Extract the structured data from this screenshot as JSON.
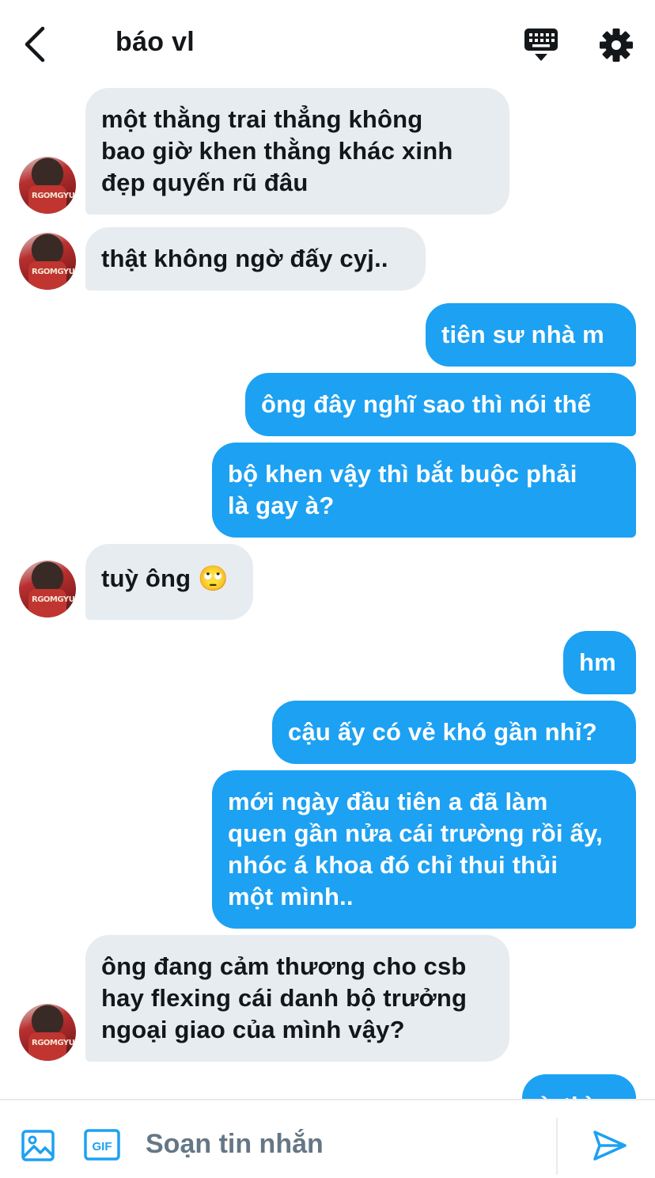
{
  "header": {
    "title": "báo vl"
  },
  "messages": [
    {
      "side": "in",
      "lines": [
        "một thằng trai thẳng không",
        "bao giờ khen thằng khác xinh",
        "đẹp quyến rũ đâu"
      ]
    },
    {
      "side": "in",
      "lines": [
        "thật không ngờ đấy cyj.."
      ]
    },
    {
      "side": "out",
      "lines": [
        "tiên sư nhà m"
      ]
    },
    {
      "side": "out",
      "lines": [
        "ông đây nghĩ sao thì nói thế"
      ]
    },
    {
      "side": "out",
      "lines": [
        "bộ khen vậy thì bắt buộc phải",
        "là gay à?"
      ]
    },
    {
      "side": "in",
      "lines": [
        "tuỳ ông"
      ],
      "emoji": "🙄"
    },
    {
      "side": "out",
      "lines": [
        "hm"
      ]
    },
    {
      "side": "out",
      "lines": [
        "cậu ấy có vẻ khó gần nhỉ?"
      ]
    },
    {
      "side": "out",
      "lines": [
        "mới ngày đầu tiên a đã làm",
        "quen gần nửa cái trường rồi ấy,",
        "nhóc á khoa đó chỉ thui thủi",
        "một mình.."
      ]
    },
    {
      "side": "in",
      "lines": [
        "ông đang cảm thương cho csb",
        "hay flexing cái danh bộ trưởng",
        "ngoại giao của mình vậy?"
      ]
    },
    {
      "side": "out",
      "lines": [
        "ừ thì"
      ]
    }
  ],
  "avatar": {
    "jersey_number": "RGOMGYU"
  },
  "composer": {
    "placeholder": "Soạn tin nhắn",
    "gif_label": "GIF"
  },
  "colors": {
    "accent": "#1da1f2",
    "incoming_bubble": "#e6ecf0",
    "text": "#14171a",
    "muted": "#657786"
  }
}
